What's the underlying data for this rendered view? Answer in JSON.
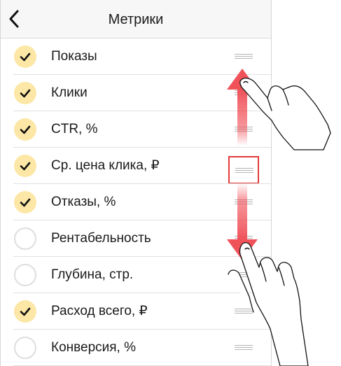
{
  "header": {
    "title": "Метрики",
    "back_icon": "chevron-left-icon"
  },
  "metrics": [
    {
      "label": "Показы",
      "checked": true
    },
    {
      "label": "Клики",
      "checked": true
    },
    {
      "label": "CTR, %",
      "checked": true
    },
    {
      "label": "Ср. цена клика, ₽",
      "checked": true,
      "drag_highlighted": true
    },
    {
      "label": "Отказы, %",
      "checked": true
    },
    {
      "label": "Рентабельность",
      "checked": false
    },
    {
      "label": "Глубина, стр.",
      "checked": false
    },
    {
      "label": "Расход всего, ₽",
      "checked": true
    },
    {
      "label": "Конверсия, %",
      "checked": false
    }
  ],
  "colors": {
    "checked_fill": "#fce7a6",
    "highlight_frame": "#e33a3a",
    "arrow": "#f0525a"
  }
}
